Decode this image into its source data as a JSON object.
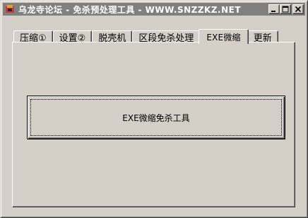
{
  "window": {
    "title": "乌龙寺论坛 - 免杀预处理工具 - WWW.SNZZKZ.NET",
    "app_icon": "app-icon",
    "titlebar_color": "#808080"
  },
  "title_buttons": {
    "minimize": "minimize-icon",
    "maximize": "maximize-icon",
    "close": "close-icon"
  },
  "tabs": [
    {
      "label": "压缩①",
      "active": false
    },
    {
      "label": "设置②",
      "active": false
    },
    {
      "label": "脱壳机",
      "active": false
    },
    {
      "label": "区段免杀处理",
      "active": false
    },
    {
      "label": "EXE微缩",
      "active": true
    },
    {
      "label": "更新",
      "active": false
    }
  ],
  "panel": {
    "main_button_label": "EXE微缩免杀工具"
  }
}
